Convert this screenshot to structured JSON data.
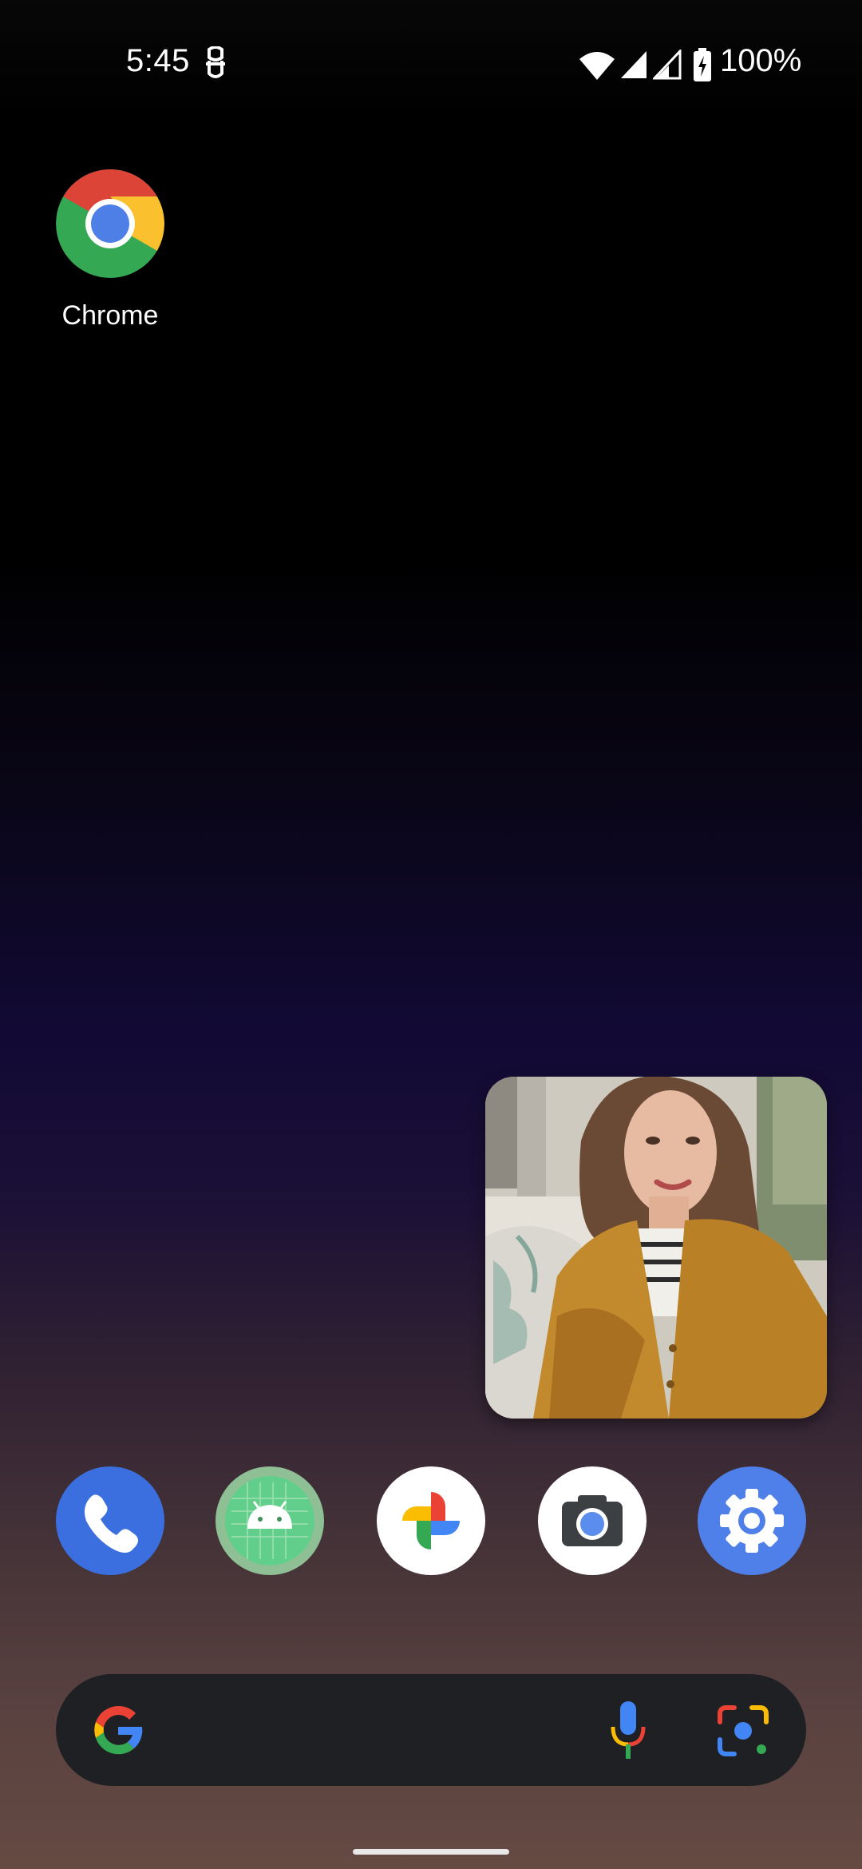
{
  "status_bar": {
    "time": "5:45",
    "battery_percent": "100%",
    "icons": [
      "notification-icon",
      "wifi-icon",
      "signal-icon",
      "signal-icon",
      "battery-charging-icon"
    ]
  },
  "home": {
    "apps": [
      {
        "label": "Chrome",
        "icon": "chrome-icon"
      }
    ]
  },
  "pip": {
    "content": "video-call-pip-window"
  },
  "dock": {
    "apps": [
      {
        "icon": "phone-icon"
      },
      {
        "icon": "android-app-icon"
      },
      {
        "icon": "photos-icon"
      },
      {
        "icon": "camera-icon"
      },
      {
        "icon": "settings-icon"
      }
    ]
  },
  "search": {
    "icons": [
      "google-logo-icon",
      "mic-icon",
      "lens-icon"
    ]
  },
  "colors": {
    "search_bar": "#1f2024",
    "phone": "#3b6fe0",
    "settings": "#4f7fe8"
  }
}
